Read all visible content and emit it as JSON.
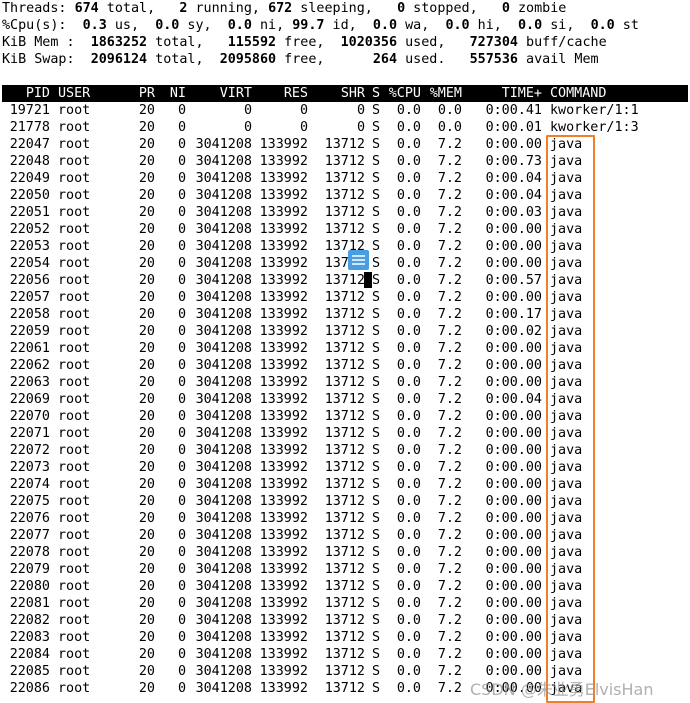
{
  "summary": [
    [
      {
        "t": "Threads: "
      },
      {
        "t": "674",
        "b": 1
      },
      {
        "t": " total,   "
      },
      {
        "t": "2",
        "b": 1
      },
      {
        "t": " running, "
      },
      {
        "t": "672",
        "b": 1
      },
      {
        "t": " sleeping,   "
      },
      {
        "t": "0",
        "b": 1
      },
      {
        "t": " stopped,   "
      },
      {
        "t": "0",
        "b": 1
      },
      {
        "t": " zombie"
      }
    ],
    [
      {
        "t": "%Cpu(s):  "
      },
      {
        "t": "0.3",
        "b": 1
      },
      {
        "t": " us,  "
      },
      {
        "t": "0.0",
        "b": 1
      },
      {
        "t": " sy,  "
      },
      {
        "t": "0.0",
        "b": 1
      },
      {
        "t": " ni, "
      },
      {
        "t": "99.7",
        "b": 1
      },
      {
        "t": " id,  "
      },
      {
        "t": "0.0",
        "b": 1
      },
      {
        "t": " wa,  "
      },
      {
        "t": "0.0",
        "b": 1
      },
      {
        "t": " hi,  "
      },
      {
        "t": "0.0",
        "b": 1
      },
      {
        "t": " si,  "
      },
      {
        "t": "0.0",
        "b": 1
      },
      {
        "t": " st"
      }
    ],
    [
      {
        "t": "KiB Mem :  "
      },
      {
        "t": "1863252",
        "b": 1
      },
      {
        "t": " total,   "
      },
      {
        "t": "115592",
        "b": 1
      },
      {
        "t": " free,  "
      },
      {
        "t": "1020356",
        "b": 1
      },
      {
        "t": " used,   "
      },
      {
        "t": "727304",
        "b": 1
      },
      {
        "t": " buff/cache"
      }
    ],
    [
      {
        "t": "KiB Swap:  "
      },
      {
        "t": "2096124",
        "b": 1
      },
      {
        "t": " total,  "
      },
      {
        "t": "2095860",
        "b": 1
      },
      {
        "t": " free,      "
      },
      {
        "t": "264",
        "b": 1
      },
      {
        "t": " used.   "
      },
      {
        "t": "557536",
        "b": 1
      },
      {
        "t": " avail Mem"
      }
    ]
  ],
  "columns": {
    "pid": "PID",
    "user": "USER",
    "pr": "PR",
    "ni": "NI",
    "virt": "VIRT",
    "res": "RES",
    "shr": "SHR",
    "s": "S",
    "cpu": "%CPU",
    "mem": "%MEM",
    "time": "TIME+",
    "cmd": "COMMAND"
  },
  "rows": [
    {
      "pid": "19721",
      "user": "root",
      "pr": "20",
      "ni": "0",
      "virt": "0",
      "res": "0",
      "shr": "0",
      "s": "S",
      "cpu": "0.0",
      "mem": "0.0",
      "time": "0:00.41",
      "cmd": "kworker/1:1"
    },
    {
      "pid": "21778",
      "user": "root",
      "pr": "20",
      "ni": "0",
      "virt": "0",
      "res": "0",
      "shr": "0",
      "s": "S",
      "cpu": "0.0",
      "mem": "0.0",
      "time": "0:00.01",
      "cmd": "kworker/1:3"
    },
    {
      "pid": "22047",
      "time": "0:00.00"
    },
    {
      "pid": "22048",
      "time": "0:00.73"
    },
    {
      "pid": "22049",
      "time": "0:00.04"
    },
    {
      "pid": "22050",
      "time": "0:00.04"
    },
    {
      "pid": "22051",
      "time": "0:00.03"
    },
    {
      "pid": "22052",
      "time": "0:00.00"
    },
    {
      "pid": "22053",
      "time": "0:00.00"
    },
    {
      "pid": "22054",
      "time": "0:00.00"
    },
    {
      "pid": "22056",
      "time": "0:00.57"
    },
    {
      "pid": "22057",
      "time": "0:00.00"
    },
    {
      "pid": "22058",
      "time": "0:00.17"
    },
    {
      "pid": "22059",
      "time": "0:00.02"
    },
    {
      "pid": "22061",
      "time": "0:00.00"
    },
    {
      "pid": "22062",
      "time": "0:00.00"
    },
    {
      "pid": "22063",
      "time": "0:00.00"
    },
    {
      "pid": "22069",
      "time": "0:00.04"
    },
    {
      "pid": "22070",
      "time": "0:00.00"
    },
    {
      "pid": "22071",
      "time": "0:00.00"
    },
    {
      "pid": "22072",
      "time": "0:00.00"
    },
    {
      "pid": "22073",
      "time": "0:00.00"
    },
    {
      "pid": "22074",
      "time": "0:00.00"
    },
    {
      "pid": "22075",
      "time": "0:00.00"
    },
    {
      "pid": "22076",
      "time": "0:00.00"
    },
    {
      "pid": "22077",
      "time": "0:00.00"
    },
    {
      "pid": "22078",
      "time": "0:00.00"
    },
    {
      "pid": "22079",
      "time": "0:00.00"
    },
    {
      "pid": "22080",
      "time": "0:00.00"
    },
    {
      "pid": "22081",
      "time": "0:00.00"
    },
    {
      "pid": "22082",
      "time": "0:00.00"
    },
    {
      "pid": "22083",
      "time": "0:00.00"
    },
    {
      "pid": "22084",
      "time": "0:00.00"
    },
    {
      "pid": "22085",
      "time": "0:00.00"
    },
    {
      "pid": "22086",
      "time": "0:00.00"
    }
  ],
  "java_defaults": {
    "user": "root",
    "pr": "20",
    "ni": "0",
    "virt": "3041208",
    "res": "133992",
    "shr": "13712",
    "s": "S",
    "cpu": "0.0",
    "mem": "7.2",
    "cmd": "java"
  },
  "highlight_color": "#f07f2c",
  "watermark": "CSDN @朱业勇ElvisHan"
}
